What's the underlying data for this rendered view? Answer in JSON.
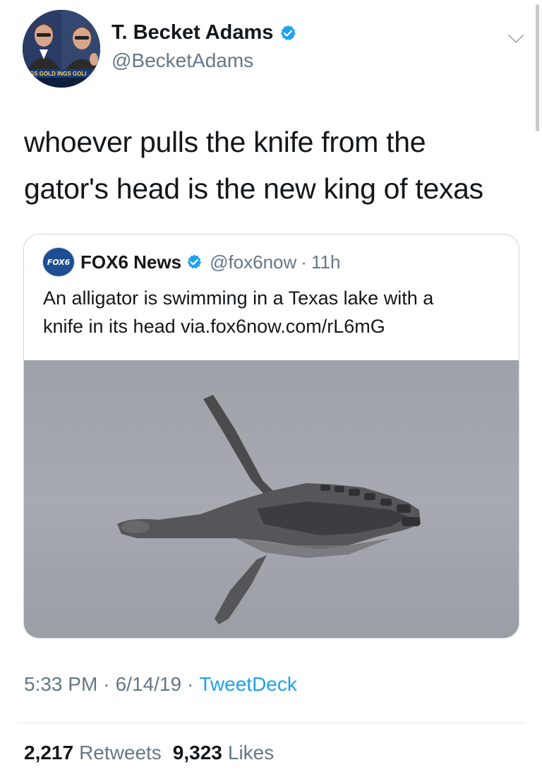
{
  "author": {
    "display_name": "T. Becket Adams",
    "handle": "@BecketAdams",
    "verified": true,
    "avatar_banner_text": "GS GOLD  INGS GOLI"
  },
  "tweet": {
    "text_line1": "whoever pulls the knife from the",
    "text_line2": "gator's head is the new king of texas"
  },
  "quote": {
    "logo_text": "FOX6",
    "display_name": "FOX6 News",
    "handle": "@fox6now",
    "separator": "·",
    "time": "11h",
    "text_line1": "An alligator is swimming in a Texas lake with a",
    "text_line2": "knife in its head via.fox6now.com/rL6mG",
    "image_subject": "alligator-with-knife-photo"
  },
  "meta": {
    "time": "5:33 PM",
    "date": "6/14/19",
    "source": "TweetDeck",
    "separator": "·"
  },
  "stats": {
    "retweets_count": "2,217",
    "retweets_label": "Retweets",
    "likes_count": "9,323",
    "likes_label": "Likes"
  },
  "colors": {
    "link": "#1da1f2",
    "secondary_text": "#657786",
    "border": "#ccd6dd"
  }
}
